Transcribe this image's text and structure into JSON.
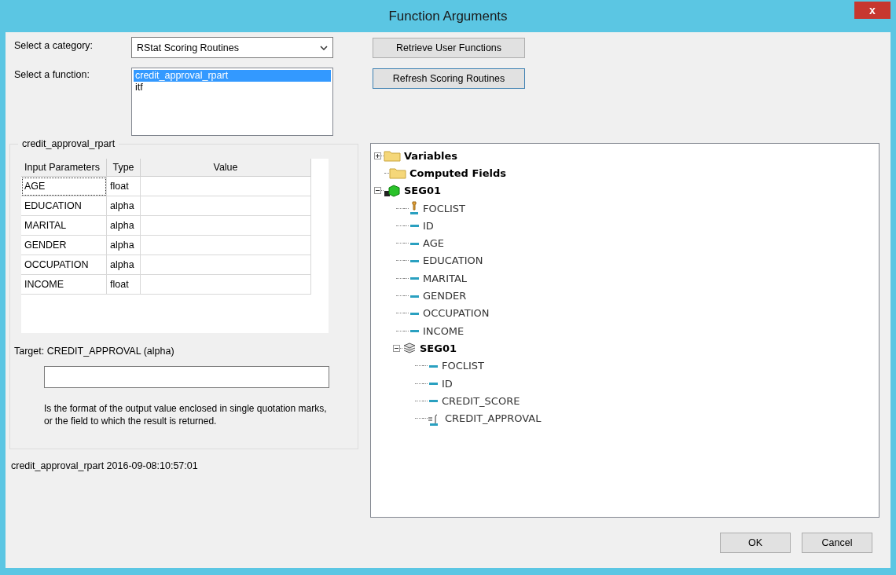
{
  "window": {
    "title": "Function Arguments",
    "close": "x"
  },
  "category": {
    "label": "Select a category:",
    "value": "RStat Scoring Routines"
  },
  "function": {
    "label": "Select a function:",
    "items": [
      {
        "label": "credit_approval_rpart",
        "selected": true
      },
      {
        "label": "itf",
        "selected": false
      }
    ]
  },
  "buttons_top": [
    "Retrieve User Functions",
    "Refresh Scoring Routines"
  ],
  "group": {
    "title": "credit_approval_rpart",
    "table": {
      "columns": [
        "Input Parameters",
        "Type",
        "Value"
      ],
      "rows": [
        {
          "parameter": "AGE",
          "type": "float",
          "focused": true
        },
        {
          "parameter": "EDUCATION",
          "type": "alpha",
          "focused": false
        },
        {
          "parameter": "MARITAL",
          "type": "alpha",
          "focused": false
        },
        {
          "parameter": "GENDER",
          "type": "alpha",
          "focused": false
        },
        {
          "parameter": "OCCUPATION",
          "type": "alpha",
          "focused": false
        },
        {
          "parameter": "INCOME",
          "type": "float",
          "focused": false
        }
      ]
    },
    "target": "Target: CREDIT_APPROVAL (alpha)",
    "description": "Is the format of the output value enclosed in single quotation marks, or the field to which the result is returned."
  },
  "footer": "credit_approval_rpart 2016-09-08:10:57:01",
  "tree": [
    {
      "label": "Variables",
      "kind": "folder",
      "expanded": false
    },
    {
      "label": "Computed Fields",
      "kind": "folder"
    },
    {
      "label": "SEG01",
      "kind": "segment",
      "expanded": true,
      "children": [
        {
          "label": "FOCLIST",
          "kind": "key"
        },
        {
          "label": "ID",
          "kind": "field"
        },
        {
          "label": "AGE",
          "kind": "field"
        },
        {
          "label": "EDUCATION",
          "kind": "field"
        },
        {
          "label": "MARITAL",
          "kind": "field"
        },
        {
          "label": "GENDER",
          "kind": "field"
        },
        {
          "label": "OCCUPATION",
          "kind": "field"
        },
        {
          "label": "INCOME",
          "kind": "field"
        },
        {
          "label": "SEG01",
          "kind": "subsegment",
          "expanded": true,
          "children": [
            {
              "label": "FOCLIST",
              "kind": "field"
            },
            {
              "label": "ID",
              "kind": "field"
            },
            {
              "label": "CREDIT_SCORE",
              "kind": "field"
            },
            {
              "label": "CREDIT_APPROVAL",
              "kind": "computed"
            }
          ]
        }
      ]
    }
  ],
  "buttons_bottom": [
    "OK",
    "Cancel"
  ]
}
